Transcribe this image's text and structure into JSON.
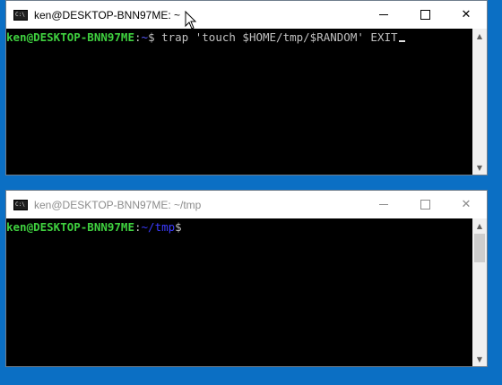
{
  "windows": [
    {
      "title": "ken@DESKTOP-BNN97ME: ~",
      "prompt_user": "ken@DESKTOP-BNN97ME",
      "prompt_colon": ":",
      "prompt_path": "~",
      "prompt_dollar": "$",
      "command": " trap 'touch $HOME/tmp/$RANDOM' EXIT",
      "active": true
    },
    {
      "title": "ken@DESKTOP-BNN97ME: ~/tmp",
      "prompt_user": "ken@DESKTOP-BNN97ME",
      "prompt_colon": ":",
      "prompt_path": "~/tmp",
      "prompt_dollar": "$",
      "command": "",
      "active": false
    }
  ],
  "icons": {
    "app": "terminal-app-icon",
    "minimize": "minimize-icon",
    "maximize": "maximize-icon",
    "close": "close-icon",
    "scroll_up": "scroll-up-arrow-icon",
    "scroll_down": "scroll-down-arrow-icon",
    "pointer": "mouse-pointer-icon"
  },
  "controls": {
    "close_glyph": "✕"
  },
  "colors": {
    "desktop": "#0b6fc4",
    "prompt_user": "#3fd03f",
    "prompt_path": "#3b3bff",
    "terminal_bg": "#000000"
  }
}
